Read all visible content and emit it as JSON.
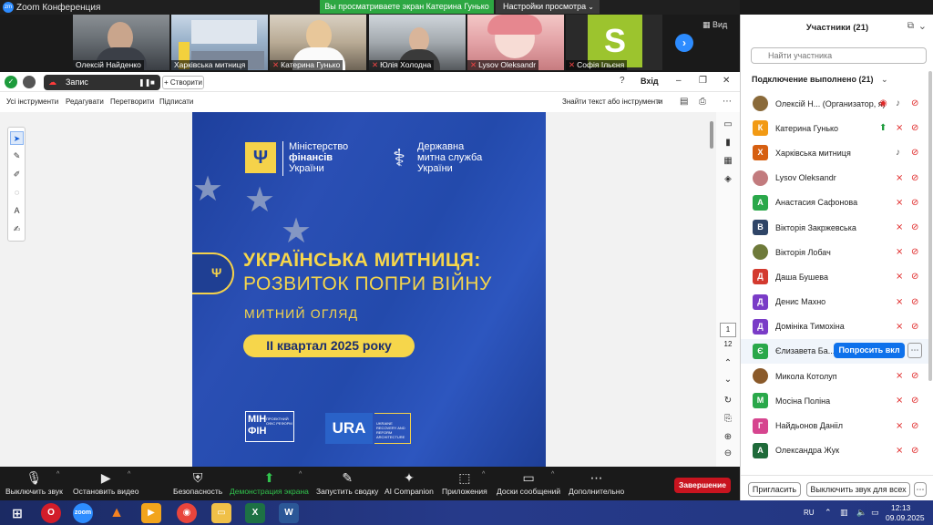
{
  "window": {
    "app_title": "Zoom Конференция",
    "share_banner": "Вы просматриваете экран Катерина Гунько",
    "view_options": "Настройки просмотра",
    "view_label": "Вид"
  },
  "video_tiles": [
    {
      "name": "Олексій Найденко",
      "muted": false
    },
    {
      "name": "Харківська митниця",
      "muted": false
    },
    {
      "name": "Катерина Гунько",
      "muted": true
    },
    {
      "name": "Юлія Холодна",
      "muted": true
    },
    {
      "name": "Lysov Oleksandr",
      "muted": true
    },
    {
      "name": "Софія Ільєня",
      "muted": true
    }
  ],
  "sofia_letter": "S",
  "shared_doc": {
    "recording_label": "Запис",
    "create_label": "+ Створити",
    "exit_label": "Вхід",
    "menus": [
      "Усі інструменти",
      "Редагувати",
      "Перетворити",
      "Підписати"
    ],
    "find_text": "Знайти текст або інструменти",
    "page_current": "1",
    "page_total": "12",
    "poster": {
      "ministry_line1": "Міністерство",
      "ministry_line2": "фінансів",
      "ministry_line3": "України",
      "customs_line1": "Державна",
      "customs_line2": "митна служба",
      "customs_line3": "України",
      "title_line1": "УКРАЇНСЬКА МИТНИЦЯ:",
      "title_line2": "РОЗВИТОК ПОПРИ ВІЙНУ",
      "subtitle": "МИТНИЙ ОГЛЯД",
      "period": "II квартал 2025 року",
      "minfin_mark": "МІН ФІН",
      "minfin_small": "ПРОЕКТНИЙ ОФІС РЕФОРМ",
      "ura_mark": "URA",
      "ura_small": "UKRAINE RECOVERY AND REFORM ARCHITECTURE"
    }
  },
  "toolbar": {
    "mute": "Выключить звук",
    "video": "Остановить видео",
    "security": "Безопасность",
    "share": "Демонстрация экрана",
    "summary": "Запустить сводку",
    "ai": "AI Companion",
    "apps": "Приложения",
    "chat": "Доски сообщений",
    "more": "Дополнительно",
    "end": "Завершение"
  },
  "participants_panel": {
    "title": "Участники (21)",
    "search_placeholder": "Найти участника",
    "section": "Подключение выполнено (21)",
    "ask_button": "Попросить вкл",
    "invite_button": "Пригласить",
    "mute_all_button": "Выключить звук для всех",
    "list": [
      {
        "initial": "",
        "name": "Олексій Н...  (Организатор, я)",
        "color": "#8a6a3a",
        "photo": true,
        "mic": "on",
        "cam": "rec"
      },
      {
        "initial": "К",
        "name": "Катерина Гунько",
        "color": "#f29a14",
        "mic": "off",
        "cam": "share"
      },
      {
        "initial": "Х",
        "name": "Харківська митниця",
        "color": "#d65f11",
        "mic": "on",
        "cam": "off"
      },
      {
        "initial": "",
        "name": "Lysov Oleksandr",
        "color": "#c27b7e",
        "photo": true,
        "mic": "off",
        "cam": "off"
      },
      {
        "initial": "А",
        "name": "Анастасия Сафонова",
        "color": "#2aa84a",
        "mic": "off",
        "cam": "off"
      },
      {
        "initial": "В",
        "name": "Вікторія Закржевська",
        "color": "#2f4567",
        "mic": "off",
        "cam": "off"
      },
      {
        "initial": "",
        "name": "Вікторія Лобач",
        "color": "#6e7a3a",
        "photo": true,
        "mic": "off",
        "cam": "off"
      },
      {
        "initial": "Д",
        "name": "Даша Бушева",
        "color": "#d33a2f",
        "mic": "off",
        "cam": "off"
      },
      {
        "initial": "Д",
        "name": "Денис Махно",
        "color": "#7a3cc7",
        "mic": "off",
        "cam": "off"
      },
      {
        "initial": "Д",
        "name": "Домініка Тимохіна",
        "color": "#7a3cc7",
        "mic": "off",
        "cam": "off"
      },
      {
        "initial": "Є",
        "name": "Єлизавета Ба...",
        "color": "#2aa84a",
        "mic": "",
        "cam": "",
        "hover": true
      },
      {
        "initial": "",
        "name": "Микола Котолуп",
        "color": "#8a5a2a",
        "photo": true,
        "mic": "off",
        "cam": "off"
      },
      {
        "initial": "М",
        "name": "Мосіна Поліна",
        "color": "#2aa84a",
        "mic": "off",
        "cam": "off"
      },
      {
        "initial": "Г",
        "name": "Найдьонов Данііл",
        "color": "#d6458f",
        "mic": "off",
        "cam": "off"
      },
      {
        "initial": "А",
        "name": "Олександра Жук",
        "color": "#1f6b3a",
        "mic": "off",
        "cam": "off"
      }
    ]
  },
  "taskbar": {
    "lang": "RU",
    "time": "12:13",
    "date": "09.09.2025"
  }
}
